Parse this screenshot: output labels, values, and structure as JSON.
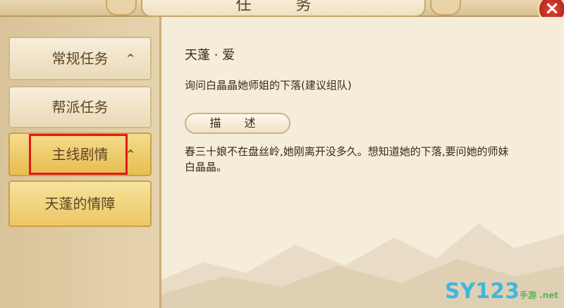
{
  "window": {
    "title": "任 务",
    "close_label": "×"
  },
  "sidebar": {
    "items": [
      {
        "label": "常规任务",
        "arrow": "^"
      },
      {
        "label": "帮派任务"
      },
      {
        "label": "主线剧情",
        "arrow": "^"
      },
      {
        "label": "天蓬的情障"
      }
    ]
  },
  "quest": {
    "title": "天蓬 · 爱",
    "goal": "询问白晶晶她师姐的下落(建议组队)",
    "section_label": "描 述",
    "description": "春三十娘不在盘丝岭,她刚离开没多久。想知道她的下落,要问她的师妹白晶晶。"
  },
  "watermark": {
    "text": "SY123",
    "suffix": "手游 .net"
  },
  "colors": {
    "highlight": "#e01a1a",
    "active_tab": "#e7bd4f",
    "close_button": "#c0281e"
  }
}
